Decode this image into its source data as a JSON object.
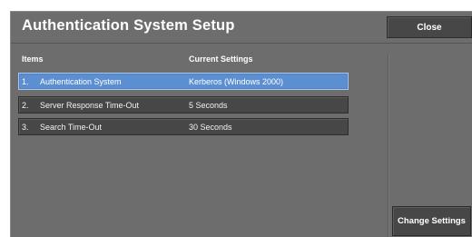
{
  "header": {
    "title": "Authentication System Setup",
    "close_label": "Close"
  },
  "table": {
    "col_items": "Items",
    "col_settings": "Current Settings",
    "rows": [
      {
        "num": "1.",
        "name": "Authentication System",
        "value": "Kerberos (Windows 2000)",
        "selected": true
      },
      {
        "num": "2.",
        "name": "Server Response Time-Out",
        "value": "5 Seconds",
        "selected": false
      },
      {
        "num": "3.",
        "name": "Search Time-Out",
        "value": "30 Seconds",
        "selected": false
      }
    ]
  },
  "footer": {
    "change_label": "Change Settings"
  },
  "colors": {
    "panel_bg": "#6d6d6d",
    "button_bg": "#474747",
    "selected_row": "#5b8fd1"
  }
}
